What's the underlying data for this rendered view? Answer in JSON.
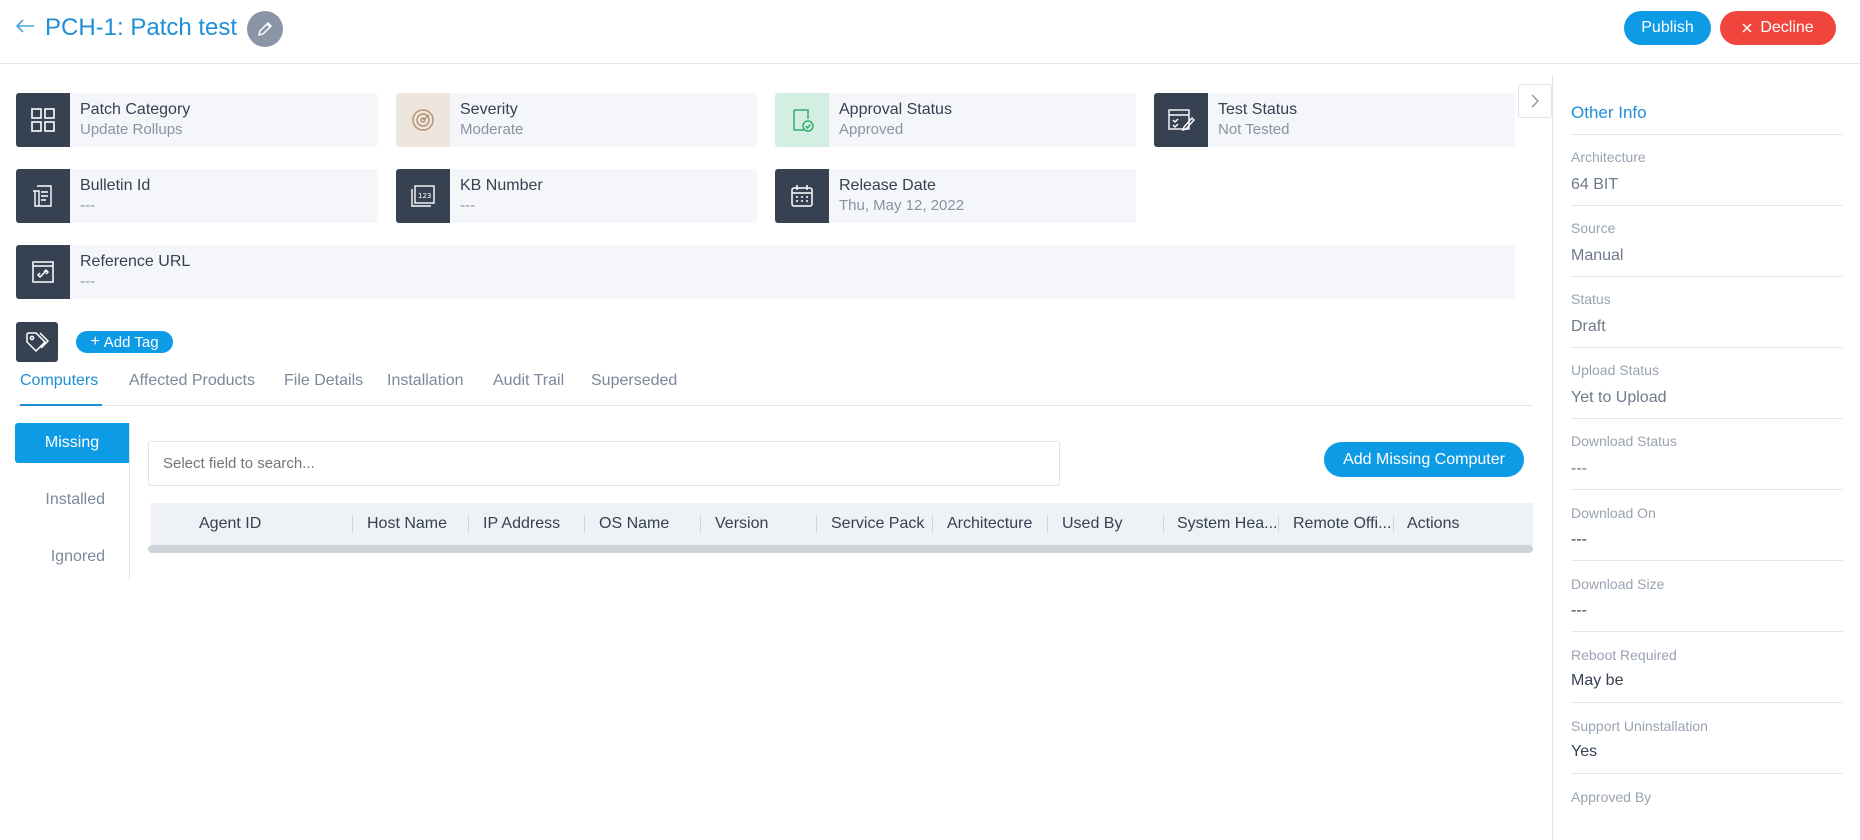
{
  "header": {
    "title": "PCH-1: Patch test",
    "publish_label": "Publish",
    "decline_label": "Decline"
  },
  "cards": {
    "patch_category": {
      "label": "Patch Category",
      "value": "Update Rollups"
    },
    "severity": {
      "label": "Severity",
      "value": "Moderate"
    },
    "approval_status": {
      "label": "Approval Status",
      "value": "Approved"
    },
    "test_status": {
      "label": "Test Status",
      "value": "Not Tested"
    },
    "bulletin_id": {
      "label": "Bulletin Id",
      "value": "---"
    },
    "kb_number": {
      "label": "KB Number",
      "value": "---"
    },
    "release_date": {
      "label": "Release Date",
      "value": "Thu, May 12, 2022"
    },
    "reference_url": {
      "label": "Reference URL",
      "value": "---"
    }
  },
  "tags": {
    "add_label": "Add Tag"
  },
  "tabs": [
    "Computers",
    "Affected Products",
    "File Details",
    "Installation",
    "Audit Trail",
    "Superseded"
  ],
  "filters": [
    "Missing",
    "Installed",
    "Ignored"
  ],
  "search": {
    "placeholder": "Select field to search..."
  },
  "add_missing_label": "Add Missing Computer",
  "table": {
    "columns": [
      "Agent ID",
      "Host Name",
      "IP Address",
      "OS Name",
      "Version",
      "Service Pack",
      "Architecture",
      "Used By",
      "System Hea...",
      "Remote Offi...",
      "Actions"
    ]
  },
  "other_info": {
    "title": "Other Info",
    "fields": [
      {
        "label": "Architecture",
        "value": "64 BIT"
      },
      {
        "label": "Source",
        "value": "Manual"
      },
      {
        "label": "Status",
        "value": "Draft"
      },
      {
        "label": "Upload Status",
        "value": "Yet to Upload"
      },
      {
        "label": "Download Status",
        "value": "---"
      },
      {
        "label": "Download On",
        "value": "---"
      },
      {
        "label": "Download Size",
        "value": "---"
      },
      {
        "label": "Reboot Required",
        "value": "May be"
      },
      {
        "label": "Support Uninstallation",
        "value": "Yes"
      },
      {
        "label": "Approved By",
        "value": ""
      }
    ]
  },
  "colors": {
    "accent": "#0e9be5",
    "danger": "#f0453d",
    "dark_icon_bg": "#364152",
    "card_bg": "#f4f6f9"
  }
}
